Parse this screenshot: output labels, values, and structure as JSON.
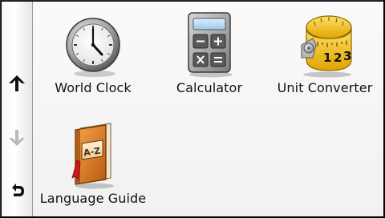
{
  "sidebar": {
    "up_icon": "arrow-up-icon",
    "down_icon": "arrow-down-icon",
    "back_icon": "back-arrow-icon"
  },
  "apps": [
    {
      "label": "World Clock",
      "icon": "clock-icon"
    },
    {
      "label": "Calculator",
      "icon": "calculator-icon"
    },
    {
      "label": "Unit Converter",
      "icon": "tape-measure-icon"
    },
    {
      "label": "Language Guide",
      "icon": "book-icon"
    }
  ],
  "icon_text": {
    "book_cover": "A-Z",
    "tape_digits": [
      "1",
      "2",
      "3"
    ]
  },
  "colors": {
    "sidebar_bg": "#ffffff",
    "content_bg": "#f5f5f5",
    "book_orange": "#d8741a",
    "tape_yellow": "#f2c21b"
  }
}
